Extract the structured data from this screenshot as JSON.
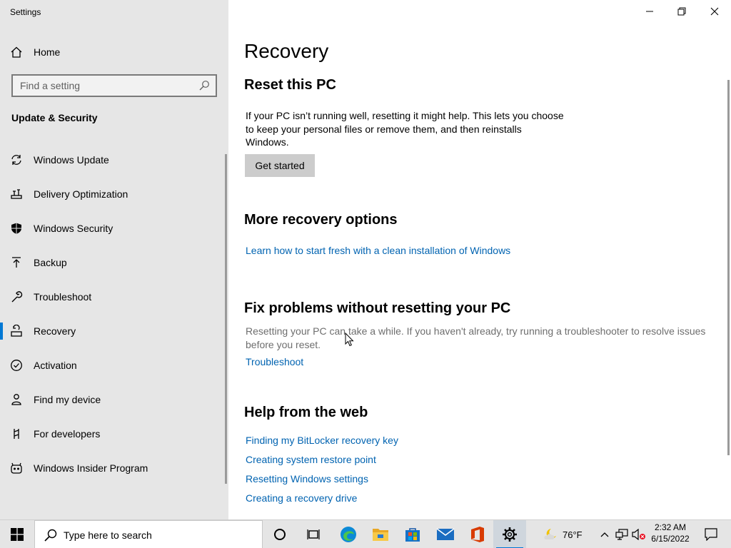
{
  "window": {
    "title": "Settings",
    "controls": [
      "minimize",
      "restore",
      "close"
    ]
  },
  "sidebar": {
    "home_label": "Home",
    "search_placeholder": "Find a setting",
    "section_heading": "Update & Security",
    "items": [
      {
        "label": "Windows Update",
        "icon": "sync-icon"
      },
      {
        "label": "Delivery Optimization",
        "icon": "delivery-optimization-icon"
      },
      {
        "label": "Windows Security",
        "icon": "shield-icon"
      },
      {
        "label": "Backup",
        "icon": "backup-icon"
      },
      {
        "label": "Troubleshoot",
        "icon": "wrench-icon"
      },
      {
        "label": "Recovery",
        "icon": "recovery-icon",
        "active": true
      },
      {
        "label": "Activation",
        "icon": "check-circle-icon"
      },
      {
        "label": "Find my device",
        "icon": "person-locate-icon"
      },
      {
        "label": "For developers",
        "icon": "developer-icon"
      },
      {
        "label": "Windows Insider Program",
        "icon": "insider-icon"
      }
    ]
  },
  "main": {
    "page_title": "Recovery",
    "reset": {
      "heading": "Reset this PC",
      "description_lines": [
        "If your PC isn’t running well, resetting it might help. This lets you choose",
        "to keep your personal files or remove them, and then reinstalls",
        "Windows."
      ],
      "button_label": "Get started"
    },
    "more_options": {
      "heading": "More recovery options",
      "link": "Learn how to start fresh with a clean installation of Windows"
    },
    "fix": {
      "heading": "Fix problems without resetting your PC",
      "description_lines": [
        "Resetting your PC can take a while. If you haven't already, try running a troubleshooter to resolve issues",
        "before you reset."
      ],
      "link": "Troubleshoot"
    },
    "web_help": {
      "heading": "Help from the web",
      "links": [
        "Finding my BitLocker recovery key",
        "Creating system restore point",
        "Resetting Windows settings",
        "Creating a recovery drive"
      ]
    }
  },
  "taskbar": {
    "search_placeholder": "Type here to search",
    "pinned": [
      "cortana-icon",
      "task-view-icon",
      "edge-icon",
      "file-explorer-icon",
      "store-icon",
      "mail-icon",
      "office-icon",
      "settings-icon"
    ],
    "weather": {
      "temp": "76°F",
      "icon": "moon-cloud-icon"
    },
    "tray": [
      "chevron-up-icon",
      "network-icon",
      "volume-muted-icon"
    ],
    "time": "2:32 AM",
    "date": "6/15/2022"
  },
  "colors": {
    "accent": "#0078d4",
    "link": "#0063b1",
    "sidebar_bg": "#e6e6e6",
    "button_bg": "#cccccc",
    "muted_text": "#6e6e6e"
  }
}
